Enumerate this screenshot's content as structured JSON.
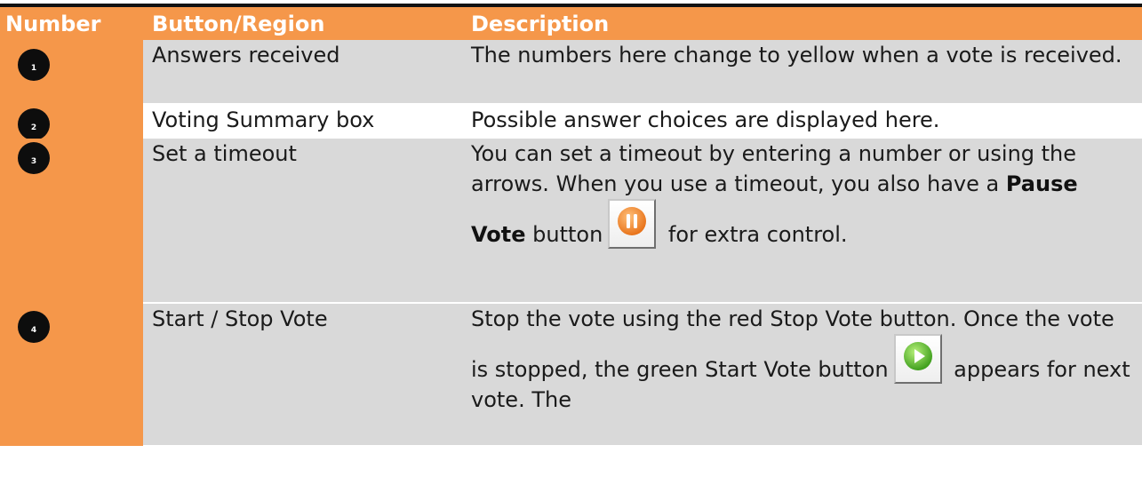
{
  "table": {
    "headers": [
      "Number",
      "Button/Region",
      "Description"
    ],
    "rows": [
      {
        "number": "1",
        "region": "Answers received",
        "description": "The numbers here change to yellow when a vote is received."
      },
      {
        "number": "2",
        "region": "Voting Summary box",
        "description": "Possible answer choices are displayed here."
      },
      {
        "number": "3",
        "region": "Set a timeout",
        "description_part1": "You can set a timeout by entering a number or using the arrows. When you use a timeout, you also have a ",
        "description_bold": "Pause Vote",
        "description_part2": " button",
        "description_part3": " for extra control."
      },
      {
        "number": "4",
        "region": "Start / Stop Vote",
        "description_part1": "Stop the vote using the red Stop Vote button. Once the vote is stopped, the green Start Vote button",
        "description_part2": " appears for next vote. The"
      }
    ]
  },
  "icons": {
    "pause": "pause-vote-icon",
    "start": "start-vote-icon"
  },
  "colors": {
    "header_bg": "#f5974a",
    "number_col_bg": "#f5974a",
    "row_shade": "#d9d9d9",
    "bullet": "#0d0d0d",
    "pause_icon": "#f08a24",
    "start_icon": "#5cbf2a"
  }
}
